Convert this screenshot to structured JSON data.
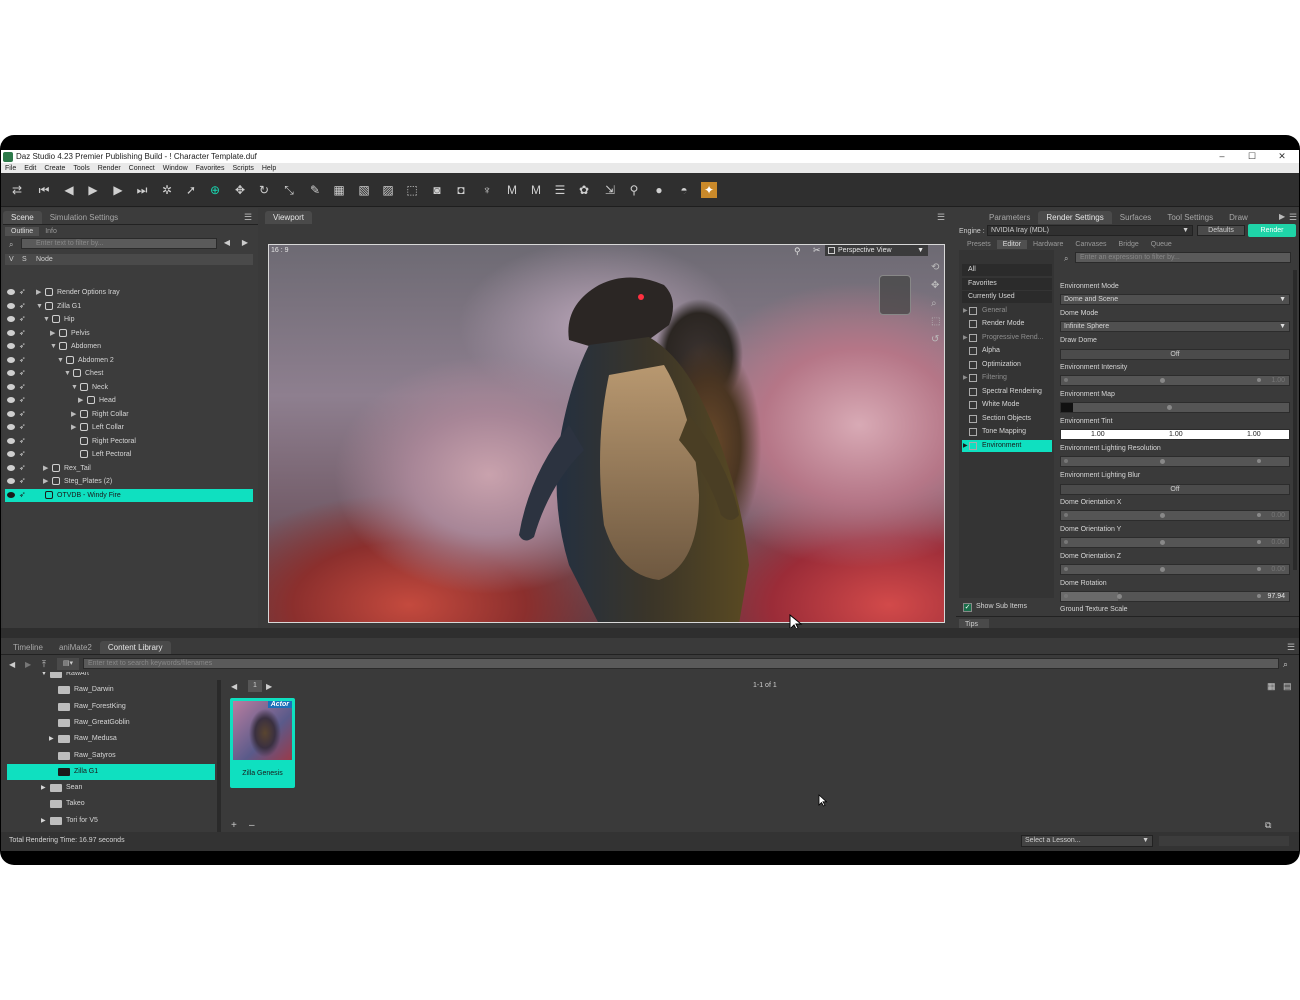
{
  "window": {
    "title": "Daz Studio 4.23 Premier Publishing Build - ! Character Template.duf",
    "controls": [
      "–",
      "☐",
      "✕"
    ]
  },
  "menu": [
    "File",
    "Edit",
    "Create",
    "Tools",
    "Render",
    "Connect",
    "Window",
    "Favorites",
    "Scripts",
    "Help"
  ],
  "toolbar_icons": [
    "loop-icon",
    "first-frame-icon",
    "prev-frame-icon",
    "play-icon",
    "next-frame-icon",
    "last-frame-icon",
    "node-select-icon",
    "pointer-icon",
    "universal-tool-icon",
    "translate-icon",
    "rotate-icon",
    "scale-icon",
    "joint-editor-icon",
    "geometry-editor-icon",
    "surface-selection-icon",
    "node-weight-icon",
    "region-tool-icon",
    "render-icon",
    "spot-render-icon",
    "figure-icon",
    "morph-icon",
    "morph-loader-icon",
    "list-icon",
    "paint-icon",
    "transfer-icon",
    "pin-icon",
    "sphere-icon",
    "dome-icon",
    "iray-icon"
  ],
  "scene_panel": {
    "tabs": [
      "Scene",
      "Simulation Settings"
    ],
    "subtabs": [
      "Outline",
      "Info"
    ],
    "filter_placeholder": "Enter text to filter by...",
    "columns": [
      "V",
      "S",
      "Node"
    ],
    "nodes": [
      {
        "label": "Render Options Iray",
        "indent": 0,
        "expand": "▶"
      },
      {
        "label": "Zilla G1",
        "indent": 0,
        "expand": "▼"
      },
      {
        "label": "Hip",
        "indent": 1,
        "expand": "▼"
      },
      {
        "label": "Pelvis",
        "indent": 2,
        "expand": "▶"
      },
      {
        "label": "Abdomen",
        "indent": 2,
        "expand": "▼"
      },
      {
        "label": "Abdomen 2",
        "indent": 3,
        "expand": "▼"
      },
      {
        "label": "Chest",
        "indent": 4,
        "expand": "▼"
      },
      {
        "label": "Neck",
        "indent": 5,
        "expand": "▼"
      },
      {
        "label": "Head",
        "indent": 6,
        "expand": "▶"
      },
      {
        "label": "Right Collar",
        "indent": 5,
        "expand": "▶"
      },
      {
        "label": "Left Collar",
        "indent": 5,
        "expand": "▶"
      },
      {
        "label": "Right Pectoral",
        "indent": 5,
        "expand": ""
      },
      {
        "label": "Left Pectoral",
        "indent": 5,
        "expand": ""
      },
      {
        "label": "Rex_Tail",
        "indent": 1,
        "expand": "▶"
      },
      {
        "label": "Steg_Plates (2)",
        "indent": 1,
        "expand": "▶"
      },
      {
        "label": "OTVDB - Windy Fire",
        "indent": 0,
        "expand": "",
        "selected": true
      }
    ]
  },
  "viewport": {
    "tab": "Viewport",
    "aspect": "16 : 9",
    "camera": "Perspective View"
  },
  "right_panel": {
    "tabs": [
      "Parameters",
      "Render Settings",
      "Surfaces",
      "Tool Settings",
      "Draw"
    ],
    "engine_label": "Engine :",
    "engine": "NVIDIA Iray (MDL)",
    "defaults_button": "Defaults",
    "render_button": "Render",
    "subtabs": [
      "Presets",
      "Editor",
      "Hardware",
      "Canvases",
      "Bridge",
      "Queue"
    ],
    "filter_placeholder": "Enter an expression to filter by...",
    "categories": [
      {
        "label": "All",
        "plain": true
      },
      {
        "label": "Favorites",
        "plain": true
      },
      {
        "label": "Currently Used",
        "plain": true
      },
      {
        "label": "General",
        "dim": true,
        "arrow": "▶"
      },
      {
        "label": "Render Mode"
      },
      {
        "label": "Progressive Rend...",
        "dim": true,
        "arrow": "▶"
      },
      {
        "label": "Alpha"
      },
      {
        "label": "Optimization"
      },
      {
        "label": "Filtering",
        "dim": true,
        "arrow": "▶"
      },
      {
        "label": "Spectral Rendering"
      },
      {
        "label": "White Mode"
      },
      {
        "label": "Section Objects"
      },
      {
        "label": "Tone Mapping"
      },
      {
        "label": "Environment",
        "selected": true,
        "arrow": "▶"
      }
    ],
    "show_sub_items": "Show Sub Items",
    "tips": "Tips",
    "properties": {
      "environment_mode": {
        "label": "Environment Mode",
        "value": "Dome and Scene"
      },
      "dome_mode": {
        "label": "Dome Mode",
        "value": "Infinite Sphere"
      },
      "draw_dome": {
        "label": "Draw Dome",
        "value": "Off"
      },
      "environment_intensity": {
        "label": "Environment Intensity",
        "value": "1.00"
      },
      "environment_map": {
        "label": "Environment Map"
      },
      "environment_tint": {
        "label": "Environment Tint",
        "r": "1.00",
        "g": "1.00",
        "b": "1.00"
      },
      "env_lighting_resolution": {
        "label": "Environment Lighting Resolution"
      },
      "env_lighting_blur": {
        "label": "Environment Lighting Blur",
        "value": "Off"
      },
      "dome_orientation_x": {
        "label": "Dome Orientation X",
        "value": "0.00"
      },
      "dome_orientation_y": {
        "label": "Dome Orientation Y",
        "value": "0.00"
      },
      "dome_orientation_z": {
        "label": "Dome Orientation Z",
        "value": "0.00"
      },
      "dome_rotation": {
        "label": "Dome Rotation",
        "value": "97.94"
      },
      "ground_texture_scale": {
        "label": "Ground Texture Scale"
      }
    }
  },
  "bottom_panel": {
    "tabs": [
      "Timeline",
      "aniMate2",
      "Content Library"
    ],
    "search_placeholder": "Enter text to search keywords/filenames",
    "folders": [
      {
        "label": "RawArt",
        "indent": 0,
        "expand": "▼"
      },
      {
        "label": "Raw_Darwin",
        "indent": 1,
        "expand": ""
      },
      {
        "label": "Raw_ForestKing",
        "indent": 1,
        "expand": ""
      },
      {
        "label": "Raw_GreatGoblin",
        "indent": 1,
        "expand": ""
      },
      {
        "label": "Raw_Medusa",
        "indent": 1,
        "expand": "▶"
      },
      {
        "label": "Raw_Satyros",
        "indent": 1,
        "expand": ""
      },
      {
        "label": "Zilla G1",
        "indent": 1,
        "expand": "",
        "selected": true
      },
      {
        "label": "Sean",
        "indent": 0,
        "expand": "▶"
      },
      {
        "label": "Takeo",
        "indent": 0,
        "expand": ""
      },
      {
        "label": "Tori for V5",
        "indent": 0,
        "expand": "▶"
      }
    ],
    "page": "1",
    "page_count": "1-1 of 1",
    "asset": {
      "badge": "Actor",
      "label": "Zilla Genesis"
    },
    "add": "+",
    "remove": "–"
  },
  "status": {
    "render_time": "Total Rendering Time: 16.97 seconds",
    "lesson": "Select a Lesson..."
  },
  "colors": {
    "accent": "#0fe0c0",
    "panel": "#3a3a3a",
    "toolbar": "#2f2f2f",
    "render_button": "#1fd4a8"
  }
}
